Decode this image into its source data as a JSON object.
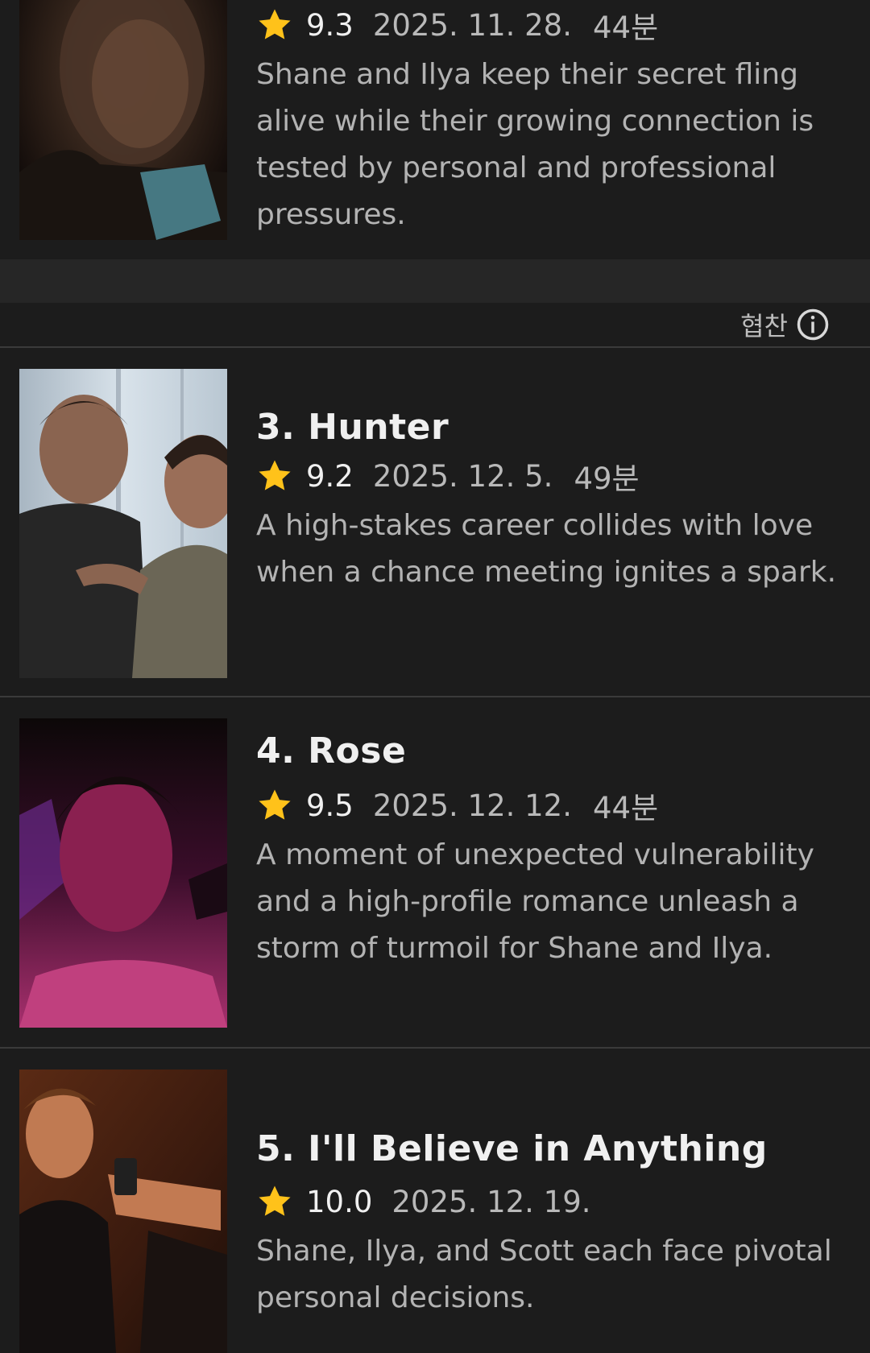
{
  "sponsor": {
    "label": "협찬",
    "icon": "info-icon"
  },
  "colors": {
    "background": "#1c1c1c",
    "star": "#ffc21a",
    "divider": "#3a3a3a"
  },
  "episodes": [
    {
      "title": "",
      "rating": "9.3",
      "date": "2025. 11. 28.",
      "duration": "44분",
      "description": "Shane and Ilya keep their secret fling alive while their growing connection is tested by personal and professional pressures."
    },
    {
      "title": "3. Hunter",
      "rating": "9.2",
      "date": "2025. 12. 5.",
      "duration": "49분",
      "description": "A high-stakes career collides with love when a chance meeting ignites a spark."
    },
    {
      "title": "4. Rose",
      "rating": "9.5",
      "date": "2025. 12. 12.",
      "duration": "44분",
      "description": "A moment of unexpected vulnerability and a high-profile romance unleash a storm of turmoil for Shane and Ilya."
    },
    {
      "title": "5. I'll Believe in Anything",
      "rating": "10.0",
      "date": "2025. 12. 19.",
      "duration": "",
      "description": "Shane, Ilya, and Scott each face pivotal personal decisions."
    }
  ]
}
